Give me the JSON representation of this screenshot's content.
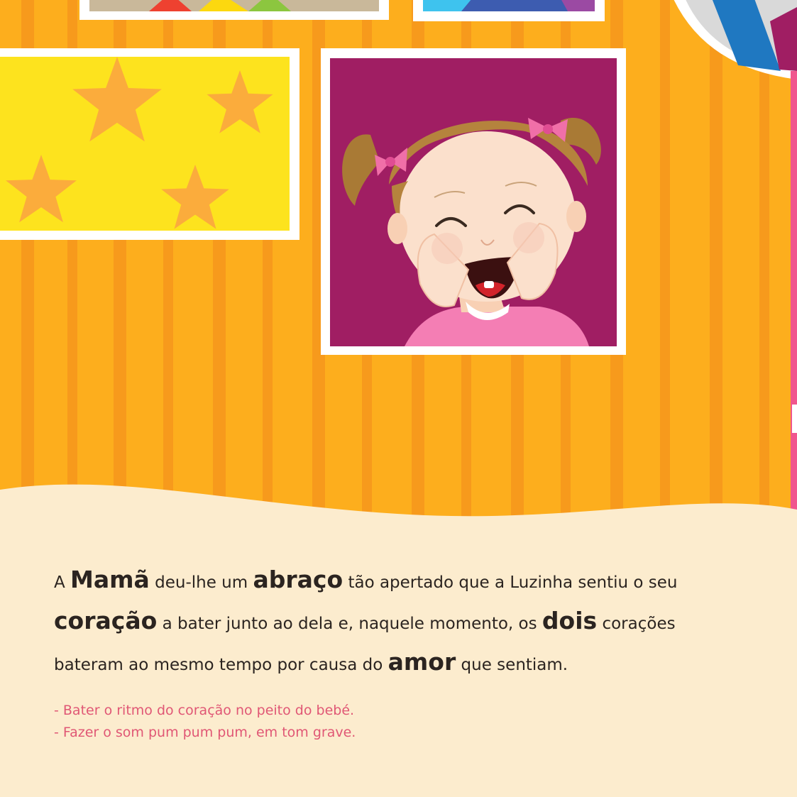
{
  "story": {
    "line1": {
      "a": "A ",
      "b": "Mamã",
      "c": " deu-lhe um ",
      "d": "abraço",
      "e": " tão apertado que a Luzinha sentiu o seu"
    },
    "line2": {
      "a": "coração",
      "b": " a bater junto ao dela e, naquele momento, os ",
      "c": "dois",
      "d": " corações"
    },
    "line3": {
      "a": "bateram ao mesmo tempo por causa do ",
      "b": "amor",
      "c": " que sentiam."
    }
  },
  "notes": [
    "- Bater o ritmo do coração no peito do bebé.",
    "- Fazer o som pum pum pum, em tom grave."
  ],
  "colors": {
    "wall": "#fdae1d",
    "wall_stripe": "#f79a1c",
    "text_panel": "#fcecce",
    "star_frame": "#fde31e",
    "star": "#fbac3c",
    "photo_frame": "#a01e63",
    "note_text": "#e05775"
  },
  "icons": [
    "star-icon",
    "girl-illustration",
    "pink-bow-icon"
  ]
}
